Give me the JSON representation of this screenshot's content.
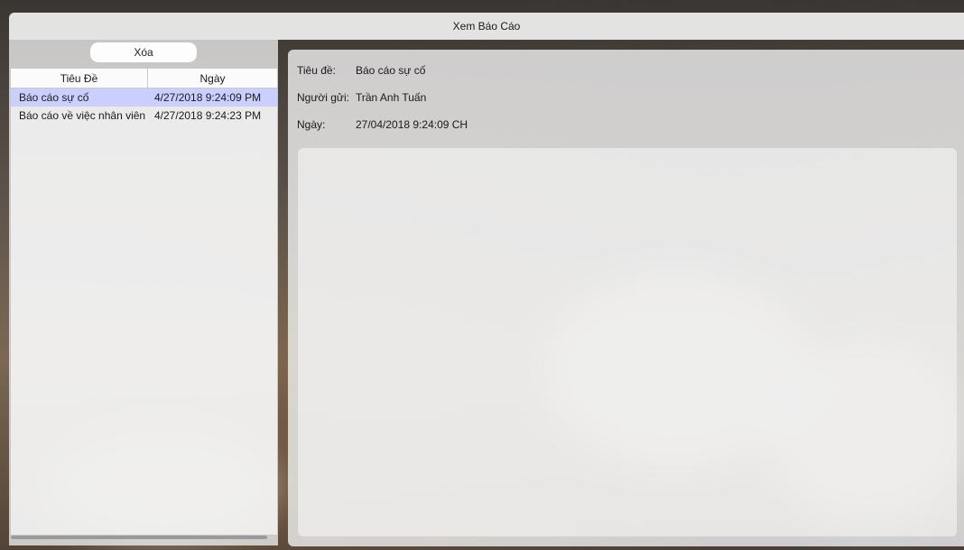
{
  "window": {
    "title": "Xem Báo Cáo"
  },
  "toolbar": {
    "delete_label": "Xóa"
  },
  "list": {
    "columns": [
      "Tiêu Đề",
      "Ngày"
    ],
    "rows": [
      {
        "title": "Báo cáo sự cố",
        "date": "4/27/2018 9:24:09 PM",
        "selected": true
      },
      {
        "title": "Báo cáo về việc nhân viên",
        "date": "4/27/2018 9:24:23 PM",
        "selected": false
      }
    ]
  },
  "detail": {
    "title_label": "Tiêu đề:",
    "title_value": "Báo cáo sự cố",
    "sender_label": "Người gửi:",
    "sender_value": "Trần Anh Tuấn",
    "date_label": "Ngày:",
    "date_value": "27/04/2018 9:24:09 CH",
    "content": ""
  },
  "colors": {
    "selected_row": "#c8cdff",
    "panel": "#eeeeee"
  }
}
